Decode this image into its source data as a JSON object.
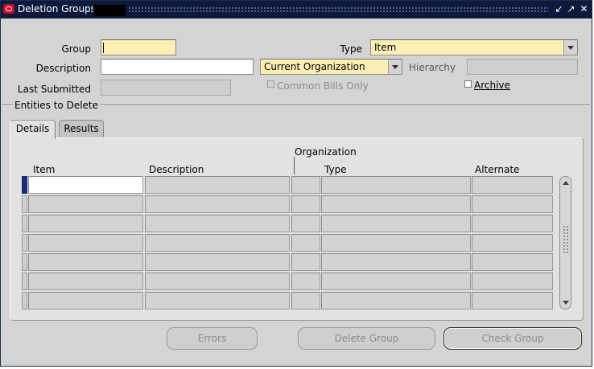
{
  "window": {
    "title": "Deletion Groups",
    "controls": {
      "minimize": "minimize-icon",
      "maximize": "maximize-icon",
      "close": "close-icon"
    }
  },
  "form": {
    "group": {
      "label": "Group",
      "value": ""
    },
    "type": {
      "label": "Type",
      "value": "Item"
    },
    "description": {
      "label": "Description",
      "value": ""
    },
    "scope": {
      "value": "Current Organization"
    },
    "hierarchy": {
      "label": "Hierarchy",
      "value": ""
    },
    "last_submitted": {
      "label": "Last Submitted",
      "value": ""
    },
    "common_bills_only": {
      "label": "Common Bills Only",
      "checked": false,
      "enabled": false
    },
    "archive": {
      "label": "Archive",
      "checked": false
    }
  },
  "section": {
    "title": "Entities to Delete"
  },
  "tabs": [
    {
      "label": "Details",
      "active": true
    },
    {
      "label": "Results",
      "active": false
    }
  ],
  "table": {
    "group_header": "Organization",
    "columns": [
      "Item",
      "Description",
      "",
      "Type",
      "Alternate"
    ],
    "rows": 7
  },
  "buttons": {
    "errors": "Errors",
    "delete_group": "Delete Group",
    "check_group": "Check Group"
  },
  "colors": {
    "titlebar": "#0d1a3d",
    "required_field": "#fdeeb3",
    "current_record": "#1c2a7a"
  }
}
